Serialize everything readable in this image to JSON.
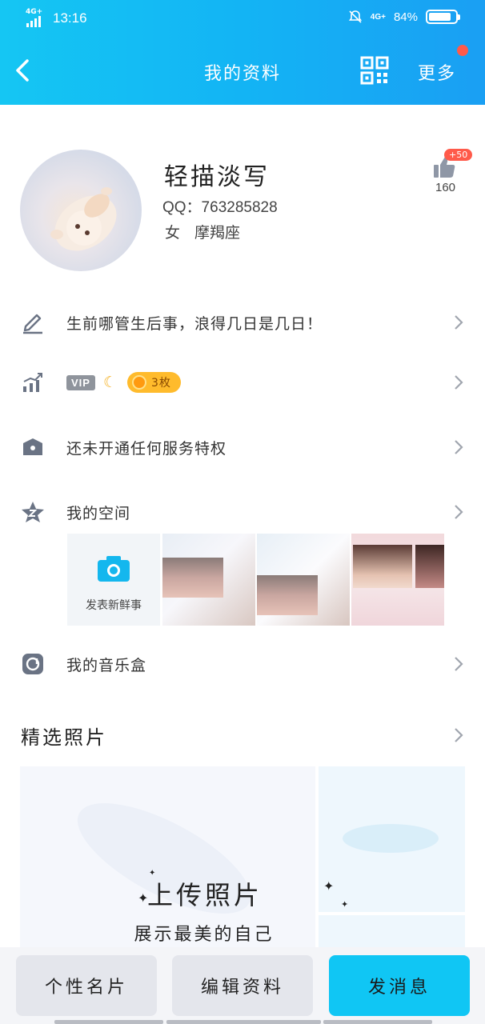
{
  "status_bar": {
    "network": "4G+",
    "time": "13:16",
    "network_right": "4G+",
    "battery_pct": "84%",
    "battery_level": 0.84
  },
  "nav": {
    "title": "我的资料",
    "more_label": "更多"
  },
  "profile": {
    "nickname": "轻描淡写",
    "qq_label": "QQ：763285828",
    "gender": "女",
    "zodiac": "摩羯座",
    "likes_badge": "+50",
    "likes_count": "160"
  },
  "rows": {
    "signature": "生前哪管生后事，浪得几日是几日！",
    "vip_tag": "VIP",
    "coins": "3枚",
    "service": "还未开通任何服务特权",
    "space": "我的空间",
    "space_post": "发表新鲜事",
    "music": "我的音乐盒"
  },
  "photos": {
    "title": "精选照片",
    "upload_title": "上传照片",
    "upload_sub": "展示最美的自己"
  },
  "bottom": {
    "card_btn": "个性名片",
    "edit_btn": "编辑资料",
    "msg_btn": "发消息"
  },
  "colors": {
    "header_start": "#15c6f3",
    "header_end": "#1a9ff3",
    "accent": "#10c6f4",
    "badge_red": "#ff5a4a",
    "coin_pill": "#ffbb2c"
  },
  "icons": [
    "back-arrow-icon",
    "qr-code-icon",
    "like-thumb-icon",
    "pencil-icon",
    "level-chart-icon",
    "moon-icon",
    "coin-icon",
    "crown-icon",
    "space-star-icon",
    "camera-icon",
    "music-disc-icon",
    "chevron-right-icon",
    "sparkle-icon"
  ]
}
